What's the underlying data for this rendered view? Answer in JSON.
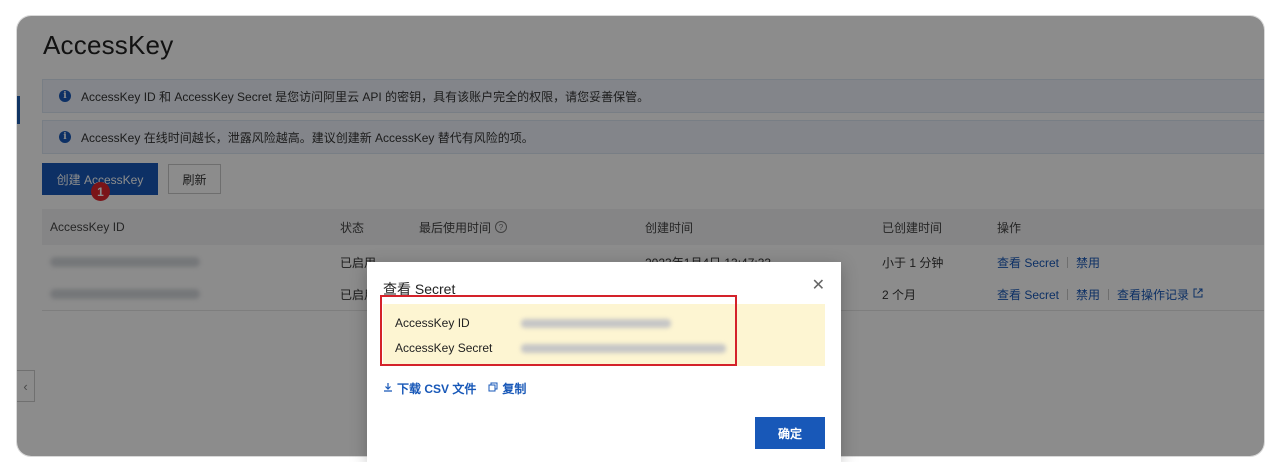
{
  "page": {
    "title": "AccessKey",
    "notices": [
      "AccessKey ID 和 AccessKey Secret 是您访问阿里云 API 的密钥，具有该账户完全的权限，请您妥善保管。",
      "AccessKey 在线时间越长，泄露风险越高。建议创建新 AccessKey 替代有风险的项。"
    ],
    "info_icon_glyph": "i",
    "toolbar": {
      "create_label": "创建 AccessKey",
      "refresh_label": "刷新",
      "step_badge": "1"
    }
  },
  "table": {
    "headers": [
      "AccessKey ID",
      "状态",
      "最后使用时间",
      "创建时间",
      "已创建时间",
      "操作"
    ],
    "help_glyph": "?",
    "rows": [
      {
        "status": "已启用",
        "last_used": "-",
        "created": "2023年1月4日 13:47:33",
        "age": "小于 1 分钟",
        "ops": [
          "查看 Secret",
          "禁用"
        ]
      },
      {
        "status": "已启用",
        "last_used": "",
        "created": "",
        "age": "2 个月",
        "ops": [
          "查看 Secret",
          "禁用",
          "查看操作记录"
        ]
      }
    ]
  },
  "sidebar": {
    "collapse_glyph": "‹"
  },
  "modal": {
    "title": "查看 Secret",
    "close_glyph": "✕",
    "fields": [
      {
        "label": "AccessKey ID"
      },
      {
        "label": "AccessKey Secret"
      }
    ],
    "download_label": "下载 CSV 文件",
    "copy_label": "复制",
    "ok_label": "确定"
  },
  "colors": {
    "primary": "#1858b8",
    "highlight_border": "#d4222a",
    "secret_bg": "#fdf5d2",
    "step_badge": "#e0262d"
  }
}
